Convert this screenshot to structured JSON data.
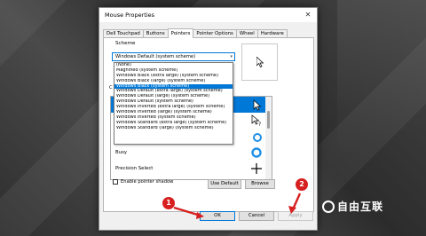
{
  "window": {
    "title": "Mouse Properties",
    "close_glyph": "✕"
  },
  "tabs": [
    {
      "label": "Dell Touchpad"
    },
    {
      "label": "Buttons"
    },
    {
      "label": "Pointers"
    },
    {
      "label": "Pointer Options"
    },
    {
      "label": "Wheel"
    },
    {
      "label": "Hardware"
    }
  ],
  "scheme": {
    "label": "Scheme",
    "selected": "Windows Default (system scheme)",
    "options": [
      "(None)",
      "Magnified (system scheme)",
      "Windows Black (extra large) (system scheme)",
      "Windows Black (large) (system scheme)",
      "Windows Black (system scheme)",
      "Windows Default (extra large) (system scheme)",
      "Windows Default (large) (system scheme)",
      "Windows Default (system scheme)",
      "Windows Inverted (extra large) (system scheme)",
      "Windows Inverted (large) (system scheme)",
      "Windows Inverted (system scheme)",
      "Windows Standard (extra large) (system scheme)",
      "Windows Standard (large) (system scheme)"
    ],
    "highlighted_index": 4
  },
  "customize": {
    "label": "C"
  },
  "cursors": [
    {
      "name": "",
      "icon": "arrow-cursor-icon"
    },
    {
      "name": "",
      "icon": "help-cursor-icon"
    },
    {
      "name": "",
      "icon": "working-cursor-icon"
    },
    {
      "name": "Busy",
      "icon": "busy-cursor-icon"
    },
    {
      "name": "Precision Select",
      "icon": "crosshair-cursor-icon"
    }
  ],
  "pointer_shadow": {
    "label": "Enable pointer shadow",
    "checked": false
  },
  "buttons": {
    "use_default": "Use Default",
    "browse": "Browse",
    "ok": "OK",
    "cancel": "Cancel",
    "apply": "Apply"
  },
  "markers": {
    "one": "1",
    "two": "2"
  },
  "watermark": {
    "text": "自由互联"
  },
  "colors": {
    "accent": "#0078d7",
    "marker": "#d71f1f"
  }
}
